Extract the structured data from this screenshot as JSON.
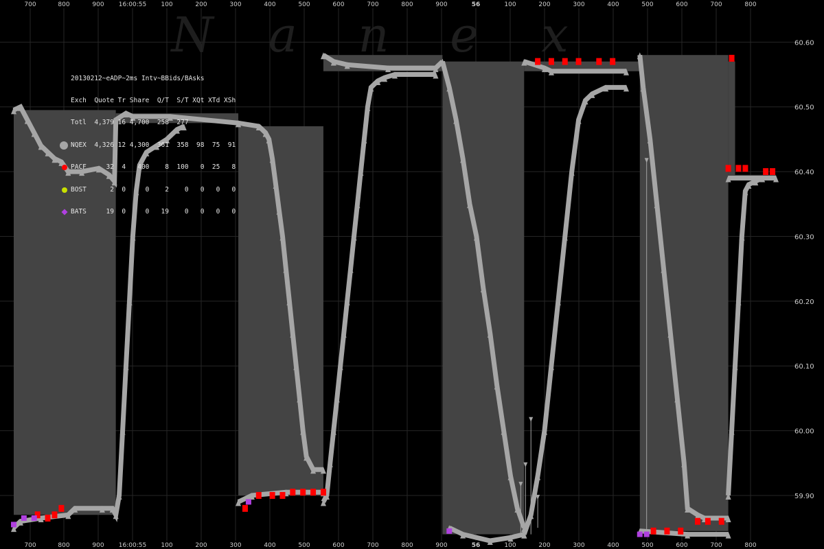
{
  "watermark": "Nanex",
  "chart_data": {
    "type": "area",
    "title": "20130212~eADP~2ms Intv~BBids/BAsks",
    "ylim": [
      59.83,
      60.63
    ],
    "y_ticks": [
      "60.60",
      "60.50",
      "60.40",
      "60.30",
      "60.20",
      "60.10",
      "60.00",
      "59.90"
    ],
    "y_tick_values": [
      60.6,
      60.5,
      60.4,
      60.3,
      60.2,
      60.1,
      60.0,
      59.9
    ],
    "x_tick_labels": [
      "700",
      "800",
      "900",
      "16:00:55",
      "100",
      "200",
      "300",
      "400",
      "500",
      "600",
      "700",
      "800",
      "900",
      "56",
      "100",
      "200",
      "300",
      "400",
      "500",
      "600",
      "700",
      "800"
    ],
    "grid": true,
    "colors": {
      "background": "#000000",
      "grid": "#262626",
      "axis_text": "#cfcfcf",
      "spread": "#444444",
      "nqex": "#a6a6a6",
      "pacf": "#ff0000",
      "bost": "#c8e000",
      "bats": "#b040e0",
      "watermark": "#1e1e1e"
    },
    "legend": {
      "header": [
        "Exch",
        "Quote",
        "Tr",
        "Share",
        "Q/T",
        "S/T",
        "XQt",
        "XTd",
        "XSh"
      ],
      "rows": [
        {
          "name": "Totl",
          "values": [
            "4,379",
            "16",
            "4,700",
            "258",
            "277",
            "",
            "",
            ""
          ]
        },
        {
          "name": "NQEX",
          "values": [
            "4,326",
            "12",
            "4,300",
            "361",
            "358",
            "98",
            "75",
            "91"
          ]
        },
        {
          "name": "PACF",
          "values": [
            "32",
            "4",
            "400",
            "8",
            "100",
            "0",
            "25",
            "8"
          ]
        },
        {
          "name": "BOST",
          "values": [
            "2",
            "0",
            "0",
            "2",
            "0",
            "0",
            "0",
            "0"
          ]
        },
        {
          "name": "BATS",
          "values": [
            "19",
            "0",
            "0",
            "19",
            "0",
            "0",
            "0",
            "0"
          ]
        }
      ]
    },
    "series": [
      {
        "name": "NQEX",
        "segments": [
          [
            [
              0,
              60.495
            ],
            [
              10,
              60.5
            ],
            [
              20,
              60.48
            ],
            [
              30,
              60.46
            ],
            [
              40,
              60.44
            ],
            [
              50,
              60.43
            ],
            [
              60,
              60.42
            ],
            [
              70,
              60.415
            ],
            [
              80,
              60.4
            ],
            [
              100,
              60.4
            ],
            [
              125,
              60.405
            ],
            [
              140,
              60.395
            ],
            [
              148,
              60.385
            ],
            [
              150,
              60.48
            ],
            [
              165,
              60.49
            ],
            [
              175,
              60.485
            ],
            [
              230,
              60.485
            ],
            [
              330,
              60.475
            ]
          ],
          [
            [
              330,
              60.475
            ],
            [
              360,
              60.47
            ],
            [
              370,
              60.46
            ],
            [
              375,
              60.45
            ],
            [
              380,
              60.42
            ],
            [
              385,
              60.38
            ],
            [
              390,
              60.34
            ],
            [
              395,
              60.3
            ],
            [
              400,
              60.25
            ],
            [
              405,
              60.2
            ],
            [
              410,
              60.15
            ],
            [
              415,
              60.1
            ],
            [
              420,
              60.05
            ],
            [
              425,
              60.0
            ],
            [
              430,
              59.96
            ],
            [
              440,
              59.94
            ],
            [
              455,
              59.94
            ]
          ],
          [
            [
              455,
              60.58
            ],
            [
              470,
              60.57
            ],
            [
              490,
              60.565
            ],
            [
              550,
              60.56
            ],
            [
              620,
              60.56
            ],
            [
              630,
              60.57
            ]
          ],
          [
            [
              630,
              60.57
            ],
            [
              640,
              60.53
            ],
            [
              650,
              60.48
            ],
            [
              660,
              60.42
            ],
            [
              670,
              60.35
            ],
            [
              680,
              60.3
            ],
            [
              690,
              60.22
            ],
            [
              700,
              60.15
            ],
            [
              710,
              60.07
            ],
            [
              720,
              60.0
            ],
            [
              730,
              59.93
            ],
            [
              740,
              59.88
            ],
            [
              750,
              59.85
            ]
          ],
          [
            [
              750,
              60.57
            ],
            [
              780,
              60.56
            ],
            [
              790,
              60.555
            ],
            [
              900,
              60.555
            ]
          ],
          [
            [
              920,
              60.58
            ],
            [
              925,
              60.53
            ],
            [
              935,
              60.45
            ],
            [
              945,
              60.35
            ],
            [
              955,
              60.25
            ],
            [
              965,
              60.15
            ],
            [
              975,
              60.05
            ],
            [
              985,
              59.95
            ],
            [
              990,
              59.88
            ],
            [
              1005,
              59.87
            ],
            [
              1015,
              59.865
            ],
            [
              1050,
              59.865
            ]
          ],
          [
            [
              1050,
              60.39
            ],
            [
              1120,
              60.39
            ]
          ]
        ]
      },
      {
        "name": "NQEX bid",
        "segments": [
          [
            [
              0,
              59.85
            ],
            [
              10,
              59.86
            ],
            [
              40,
              59.865
            ],
            [
              80,
              59.87
            ],
            [
              90,
              59.88
            ],
            [
              130,
              59.88
            ],
            [
              145,
              59.88
            ],
            [
              150,
              59.87
            ],
            [
              155,
              59.9
            ],
            [
              160,
              60.0
            ],
            [
              165,
              60.1
            ],
            [
              170,
              60.2
            ],
            [
              175,
              60.3
            ],
            [
              180,
              60.37
            ],
            [
              185,
              60.41
            ],
            [
              195,
              60.43
            ],
            [
              210,
              60.44
            ],
            [
              225,
              60.45
            ],
            [
              240,
              60.465
            ],
            [
              250,
              60.47
            ]
          ],
          [
            [
              330,
              59.89
            ],
            [
              350,
              59.9
            ],
            [
              400,
              59.905
            ],
            [
              455,
              59.905
            ]
          ],
          [
            [
              455,
              59.89
            ],
            [
              460,
              59.9
            ],
            [
              465,
              59.95
            ],
            [
              470,
              60.0
            ],
            [
              475,
              60.05
            ],
            [
              480,
              60.1
            ],
            [
              485,
              60.15
            ],
            [
              490,
              60.2
            ],
            [
              495,
              60.25
            ],
            [
              500,
              60.3
            ],
            [
              505,
              60.35
            ],
            [
              510,
              60.4
            ],
            [
              515,
              60.45
            ],
            [
              520,
              60.5
            ],
            [
              525,
              60.53
            ],
            [
              535,
              60.54
            ],
            [
              545,
              60.545
            ],
            [
              560,
              60.55
            ],
            [
              620,
              60.55
            ]
          ],
          [
            [
              640,
              59.85
            ],
            [
              660,
              59.84
            ],
            [
              700,
              59.83
            ],
            [
              730,
              59.835
            ],
            [
              750,
              59.84
            ]
          ],
          [
            [
              750,
              59.84
            ],
            [
              760,
              59.87
            ],
            [
              770,
              59.93
            ],
            [
              780,
              60.0
            ],
            [
              790,
              60.1
            ],
            [
              800,
              60.2
            ],
            [
              810,
              60.3
            ],
            [
              820,
              60.4
            ],
            [
              830,
              60.48
            ],
            [
              840,
              60.51
            ],
            [
              850,
              60.52
            ],
            [
              870,
              60.53
            ],
            [
              900,
              60.53
            ]
          ],
          [
            [
              920,
              59.845
            ],
            [
              990,
              59.84
            ],
            [
              1050,
              59.84
            ]
          ],
          [
            [
              1050,
              59.9
            ],
            [
              1055,
              60.0
            ],
            [
              1060,
              60.1
            ],
            [
              1065,
              60.2
            ],
            [
              1070,
              60.3
            ],
            [
              1075,
              60.37
            ],
            [
              1080,
              60.38
            ],
            [
              1090,
              60.385
            ],
            [
              1100,
              60.39
            ]
          ]
        ]
      }
    ],
    "blocks": [
      {
        "x": [
          0,
          150
        ],
        "y": [
          59.87,
          60.495
        ]
      },
      {
        "x": [
          150,
          330
        ],
        "y": [
          60.475,
          60.49
        ]
      },
      {
        "x": [
          330,
          455
        ],
        "y": [
          59.9,
          60.47
        ]
      },
      {
        "x": [
          455,
          630
        ],
        "y": [
          60.555,
          60.58
        ]
      },
      {
        "x": [
          630,
          750
        ],
        "y": [
          59.84,
          60.57
        ]
      },
      {
        "x": [
          750,
          920
        ],
        "y": [
          60.555,
          60.57
        ]
      },
      {
        "x": [
          920,
          1050
        ],
        "y": [
          59.845,
          60.58
        ]
      },
      {
        "x": [
          1050,
          1060
        ],
        "y": [
          60.39,
          60.57
        ]
      },
      {
        "x": [
          1060,
          1120
        ],
        "y": [
          60.39,
          60.395
        ]
      }
    ],
    "pacf_points": [
      [
        35,
        59.87
      ],
      [
        50,
        59.865
      ],
      [
        60,
        59.87
      ],
      [
        70,
        59.88
      ],
      [
        340,
        59.88
      ],
      [
        360,
        59.9
      ],
      [
        380,
        59.9
      ],
      [
        395,
        59.9
      ],
      [
        410,
        59.905
      ],
      [
        425,
        59.905
      ],
      [
        440,
        59.905
      ],
      [
        455,
        59.905
      ],
      [
        770,
        60.57
      ],
      [
        790,
        60.57
      ],
      [
        810,
        60.57
      ],
      [
        830,
        60.57
      ],
      [
        860,
        60.57
      ],
      [
        880,
        60.57
      ],
      [
        940,
        59.845
      ],
      [
        960,
        59.845
      ],
      [
        980,
        59.845
      ],
      [
        1005,
        59.86
      ],
      [
        1020,
        59.86
      ],
      [
        1040,
        59.86
      ],
      [
        1050,
        60.405
      ],
      [
        1065,
        60.405
      ],
      [
        1075,
        60.405
      ],
      [
        1055,
        60.575
      ],
      [
        1105,
        60.4
      ],
      [
        1115,
        60.4
      ]
    ],
    "bost_points": [],
    "bats_points": [
      [
        0,
        59.855
      ],
      [
        15,
        59.865
      ],
      [
        30,
        59.865
      ],
      [
        345,
        59.89
      ],
      [
        640,
        59.845
      ],
      [
        920,
        59.84
      ],
      [
        930,
        59.84
      ]
    ],
    "spikes": [
      [
        745,
        59.84,
        59.92
      ],
      [
        752,
        59.84,
        59.95
      ],
      [
        760,
        59.84,
        60.02
      ],
      [
        770,
        59.85,
        59.9
      ],
      [
        930,
        59.84,
        60.42
      ]
    ]
  }
}
